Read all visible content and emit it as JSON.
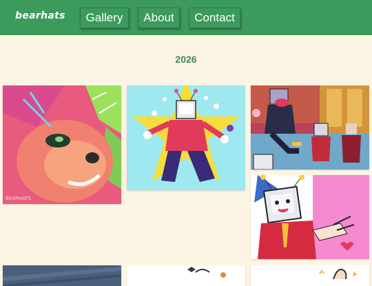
{
  "header": {
    "logo_text": "bearhats",
    "nav": [
      {
        "label": "Gallery"
      },
      {
        "label": "About"
      },
      {
        "label": "Contact"
      }
    ]
  },
  "gallery": {
    "year_heading": "2026",
    "artworks": [
      {
        "name": "pink-bear-portrait",
        "signature": "BEARHATS"
      },
      {
        "name": "tv-head-host-yellow-star"
      },
      {
        "name": "group-scene-stage"
      },
      {
        "name": "tv-head-pink-background"
      },
      {
        "name": "dark-blue-piece"
      },
      {
        "name": "white-sketch-piece"
      },
      {
        "name": "hand-sketch-piece"
      }
    ]
  },
  "colors": {
    "header_bg": "#3c9a5c",
    "page_bg": "#fdf5e3",
    "heading": "#3c8a56"
  }
}
